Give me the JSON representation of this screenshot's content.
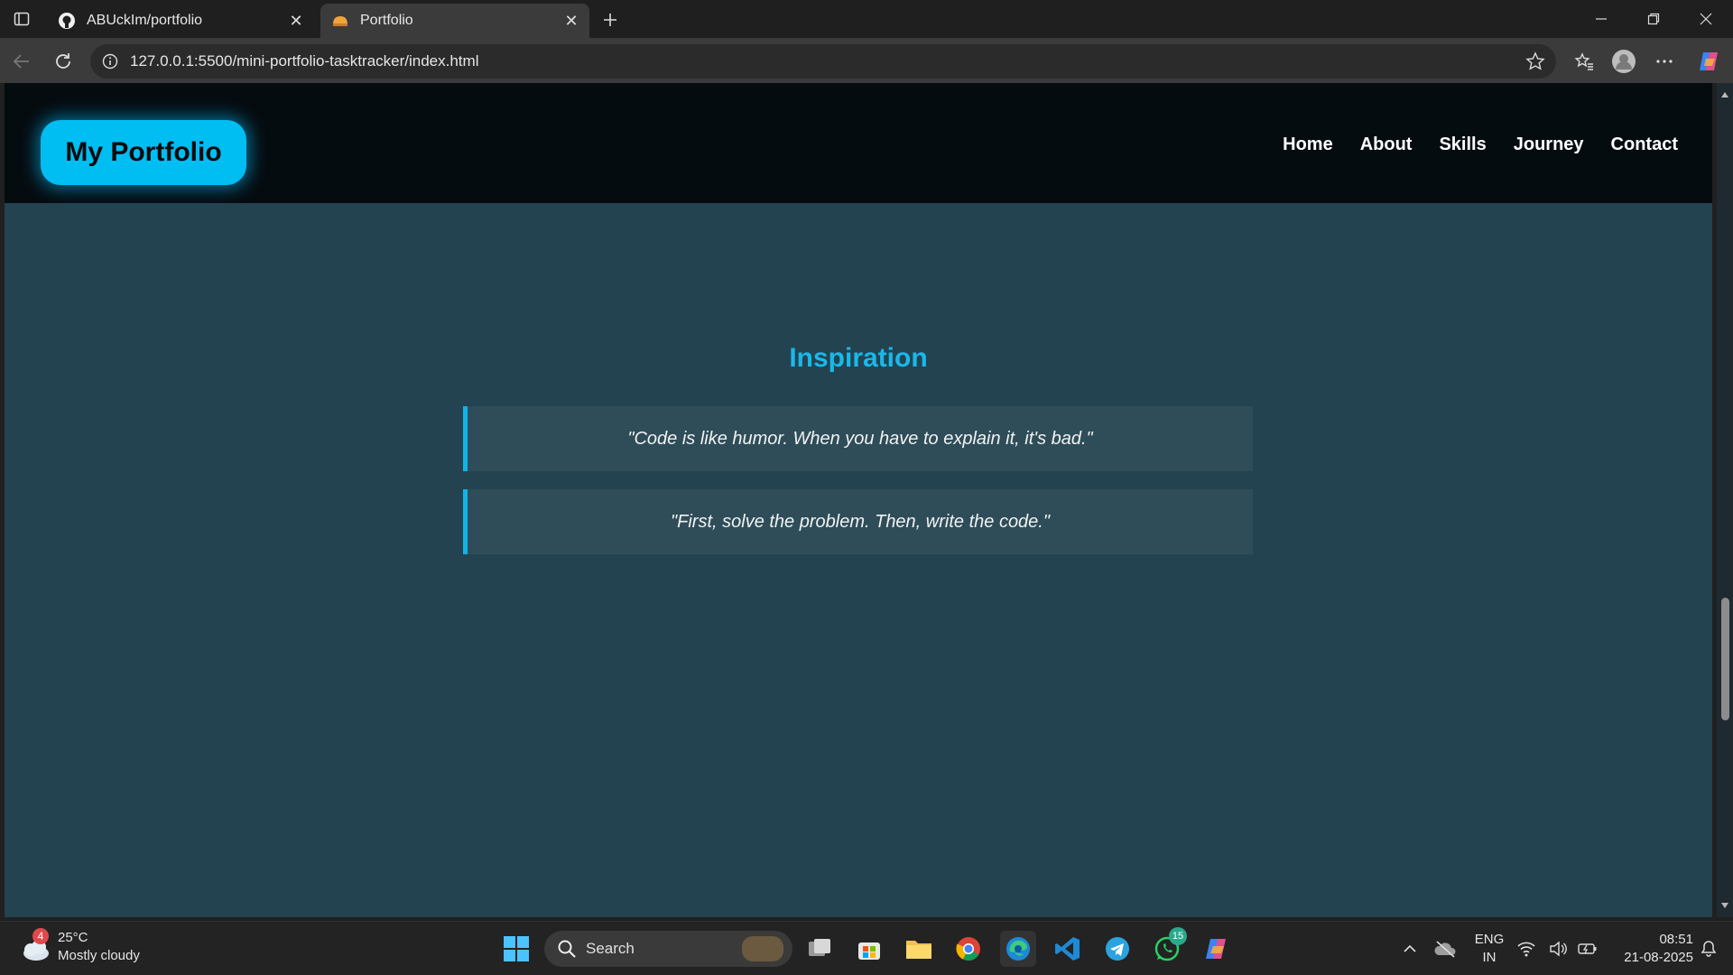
{
  "browser": {
    "tabs": [
      {
        "title": "ABUckIm/portfolio",
        "favicon": "github-icon",
        "active": false
      },
      {
        "title": "Portfolio",
        "favicon": "page-icon",
        "active": true
      }
    ],
    "url": "127.0.0.1:5500/mini-portfolio-tasktracker/index.html"
  },
  "site": {
    "logo": "My Portfolio",
    "nav": [
      "Home",
      "About",
      "Skills",
      "Journey",
      "Contact"
    ],
    "section_title": "Inspiration",
    "quotes": [
      "\"Code is like humor. When you have to explain it, it's bad.\"",
      "\"First, solve the problem. Then, write the code.\""
    ],
    "colors": {
      "accent": "#00bdf2",
      "header_bg": "#050c10",
      "page_bg": "#234350",
      "quote_bg": "#2e4d59"
    }
  },
  "taskbar": {
    "weather": {
      "badge": "4",
      "temp": "25°C",
      "condition": "Mostly cloudy"
    },
    "search_label": "Search",
    "whatsapp_badge": "15",
    "lang": {
      "line1": "ENG",
      "line2": "IN"
    },
    "clock": {
      "time": "08:51",
      "date": "21-08-2025"
    }
  }
}
